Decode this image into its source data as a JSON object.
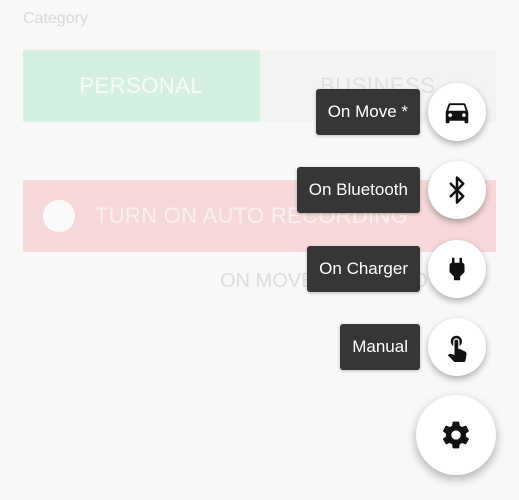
{
  "category": {
    "label": "Category"
  },
  "segmented": {
    "personal": "PERSONAL",
    "business": "BUSINESS"
  },
  "auto_recording": {
    "label": "TURN ON AUTO RECORDING"
  },
  "subtext": "ON MOVE • BLUETOOTH",
  "speed_dial": [
    {
      "label": "On Move *",
      "icon": "car-icon"
    },
    {
      "label": "On Bluetooth",
      "icon": "bluetooth-icon"
    },
    {
      "label": "On Charger",
      "icon": "plug-icon"
    },
    {
      "label": "Manual",
      "icon": "hand-tap-icon"
    }
  ],
  "main_fab": {
    "icon": "gear-icon"
  },
  "colors": {
    "personal_bg": "#c2ead5",
    "autorec_bg": "#f6c8c8",
    "label_bg": "#363636"
  }
}
